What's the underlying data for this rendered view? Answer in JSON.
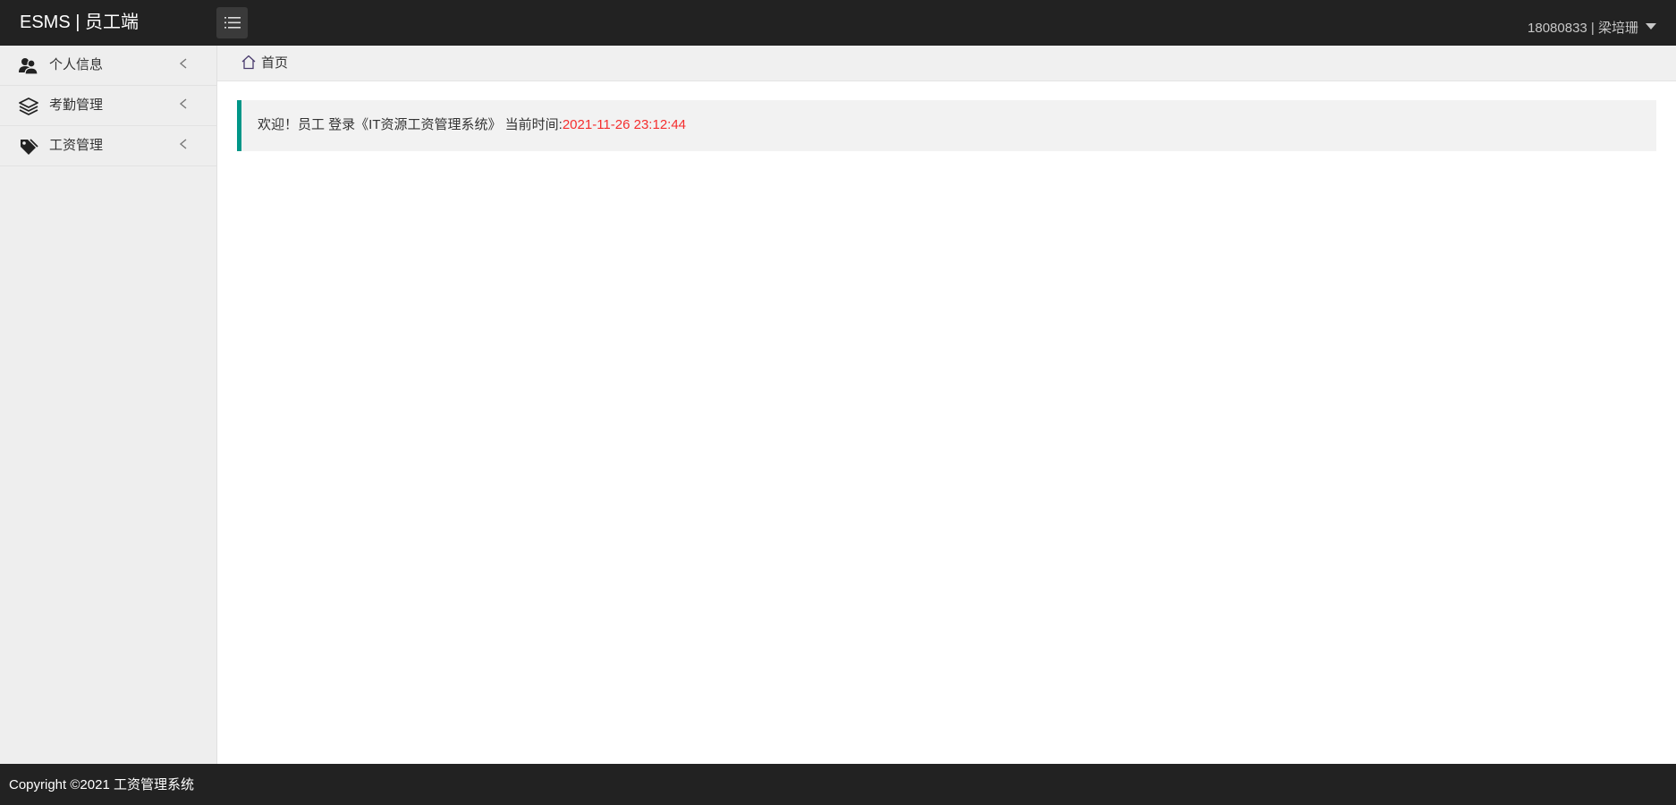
{
  "header": {
    "logo": "ESMS | 员工端",
    "user_label": "18080833 | 梁培珊"
  },
  "sidebar": {
    "items": [
      {
        "label": "个人信息",
        "icon": "users-icon"
      },
      {
        "label": "考勤管理",
        "icon": "layers-icon"
      },
      {
        "label": "工资管理",
        "icon": "tags-icon"
      }
    ]
  },
  "breadcrumb": {
    "home_label": "首页"
  },
  "welcome": {
    "text": "欢迎！员工 登录《IT资源工资管理系统》 当前时间:",
    "time": "2021-11-26 23:12:44"
  },
  "footer": {
    "copyright": "Copyright ©2021 工资管理系统"
  },
  "colors": {
    "header_bg": "#222222",
    "accent": "#009688",
    "time_color": "#f52e2e",
    "sidebar_bg": "#eeeeee"
  }
}
